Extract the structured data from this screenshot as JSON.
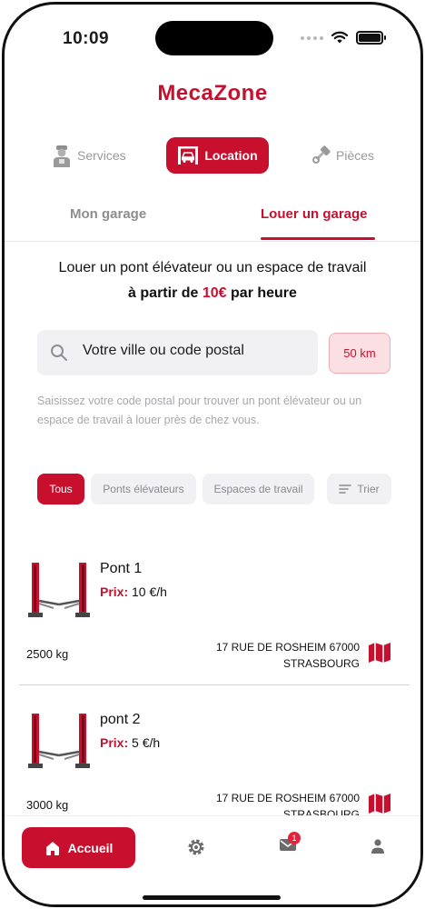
{
  "status_bar": {
    "time": "10:09"
  },
  "brand": {
    "name": "MecaZone",
    "color": "#c8102e"
  },
  "segments": [
    {
      "label": "Services",
      "icon": "mechanic-icon"
    },
    {
      "label": "Location",
      "icon": "car-lift-icon",
      "active": true
    },
    {
      "label": "Pièces",
      "icon": "piston-icon"
    }
  ],
  "tabs": [
    {
      "label": "Mon garage"
    },
    {
      "label": "Louer un garage",
      "active": true
    }
  ],
  "intro": {
    "line1": "Louer un pont élévateur ou un espace de travail",
    "prefix": "à partir de",
    "price": "10€",
    "suffix": "par heure"
  },
  "search": {
    "value": "Votre ville ou code postal",
    "radius": "50 km",
    "help": "Saisissez votre code postal pour trouver un pont élévateur ou un espace de travail à louer près de chez vous."
  },
  "filters": {
    "all": "Tous",
    "lifts": "Ponts élévateurs",
    "spaces": "Espaces de travail",
    "sort": "Trier",
    "selected": "Tous"
  },
  "listings": [
    {
      "name": "Pont 1",
      "price_label": "Prix:",
      "price": "10 €/h",
      "weight": "2500 kg",
      "address_line1": "17 RUE DE ROSHEIM 67000",
      "address_line2": "STRASBOURG"
    },
    {
      "name": "pont 2",
      "price_label": "Prix:",
      "price": "5 €/h",
      "weight": "3000 kg",
      "address_line1": "17 RUE DE ROSHEIM 67000",
      "address_line2": "STRASBOURG"
    }
  ],
  "bottom_nav": {
    "home_label": "Accueil",
    "messages_badge": "1"
  },
  "colors": {
    "accent": "#c8102e",
    "accent_light": "#fbe0e3",
    "chip_bg": "#f1f1f3"
  }
}
